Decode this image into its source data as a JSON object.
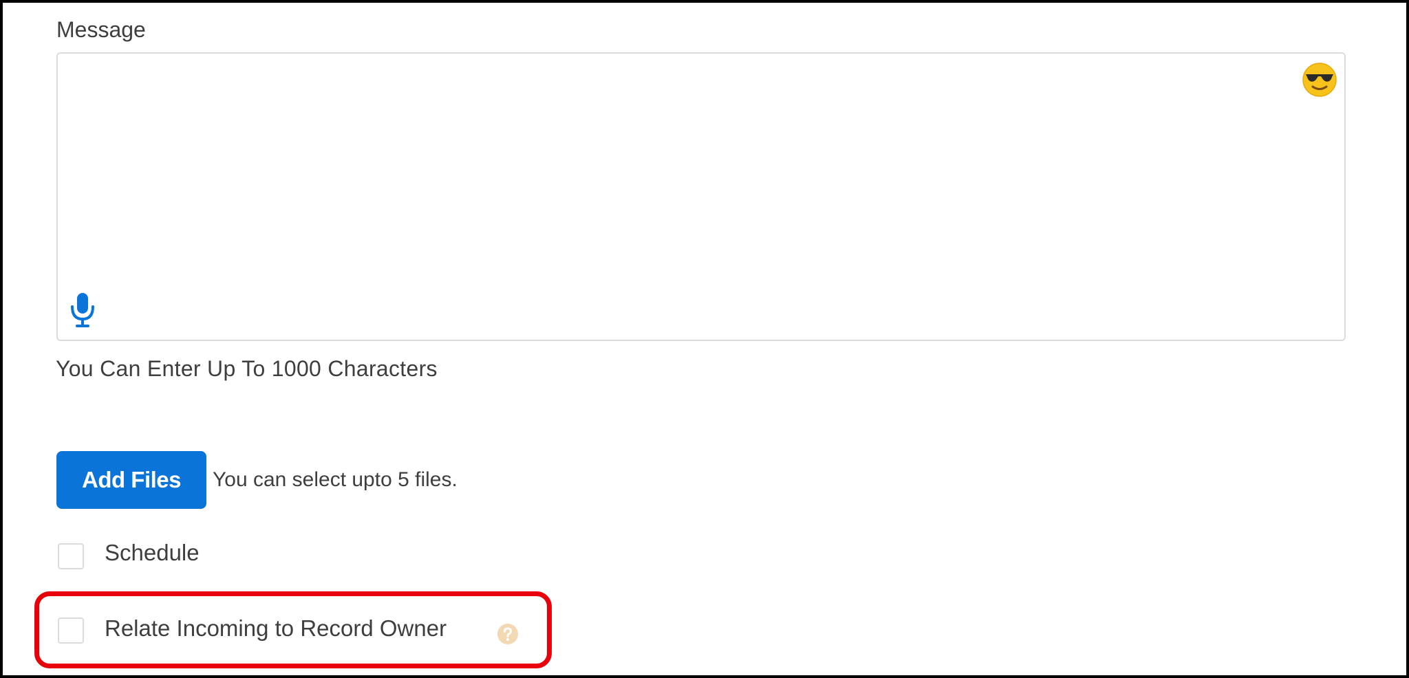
{
  "message": {
    "label": "Message",
    "value": "",
    "emoji_icon": "smiling-face-with-sunglasses-icon",
    "mic_icon": "microphone-icon"
  },
  "helper_text": "You Can Enter Up To 1000 Characters",
  "files": {
    "button_label": "Add Files",
    "hint": "You can select upto 5 files."
  },
  "options": {
    "schedule": {
      "label": "Schedule",
      "checked": false
    },
    "relate_incoming": {
      "label": "Relate Incoming to Record Owner",
      "checked": false,
      "help_icon": "question-mark-icon"
    }
  },
  "colors": {
    "accent": "#0b74d8",
    "highlight": "#e8000b",
    "border": "#dddbda",
    "text": "#3e3e3c"
  }
}
